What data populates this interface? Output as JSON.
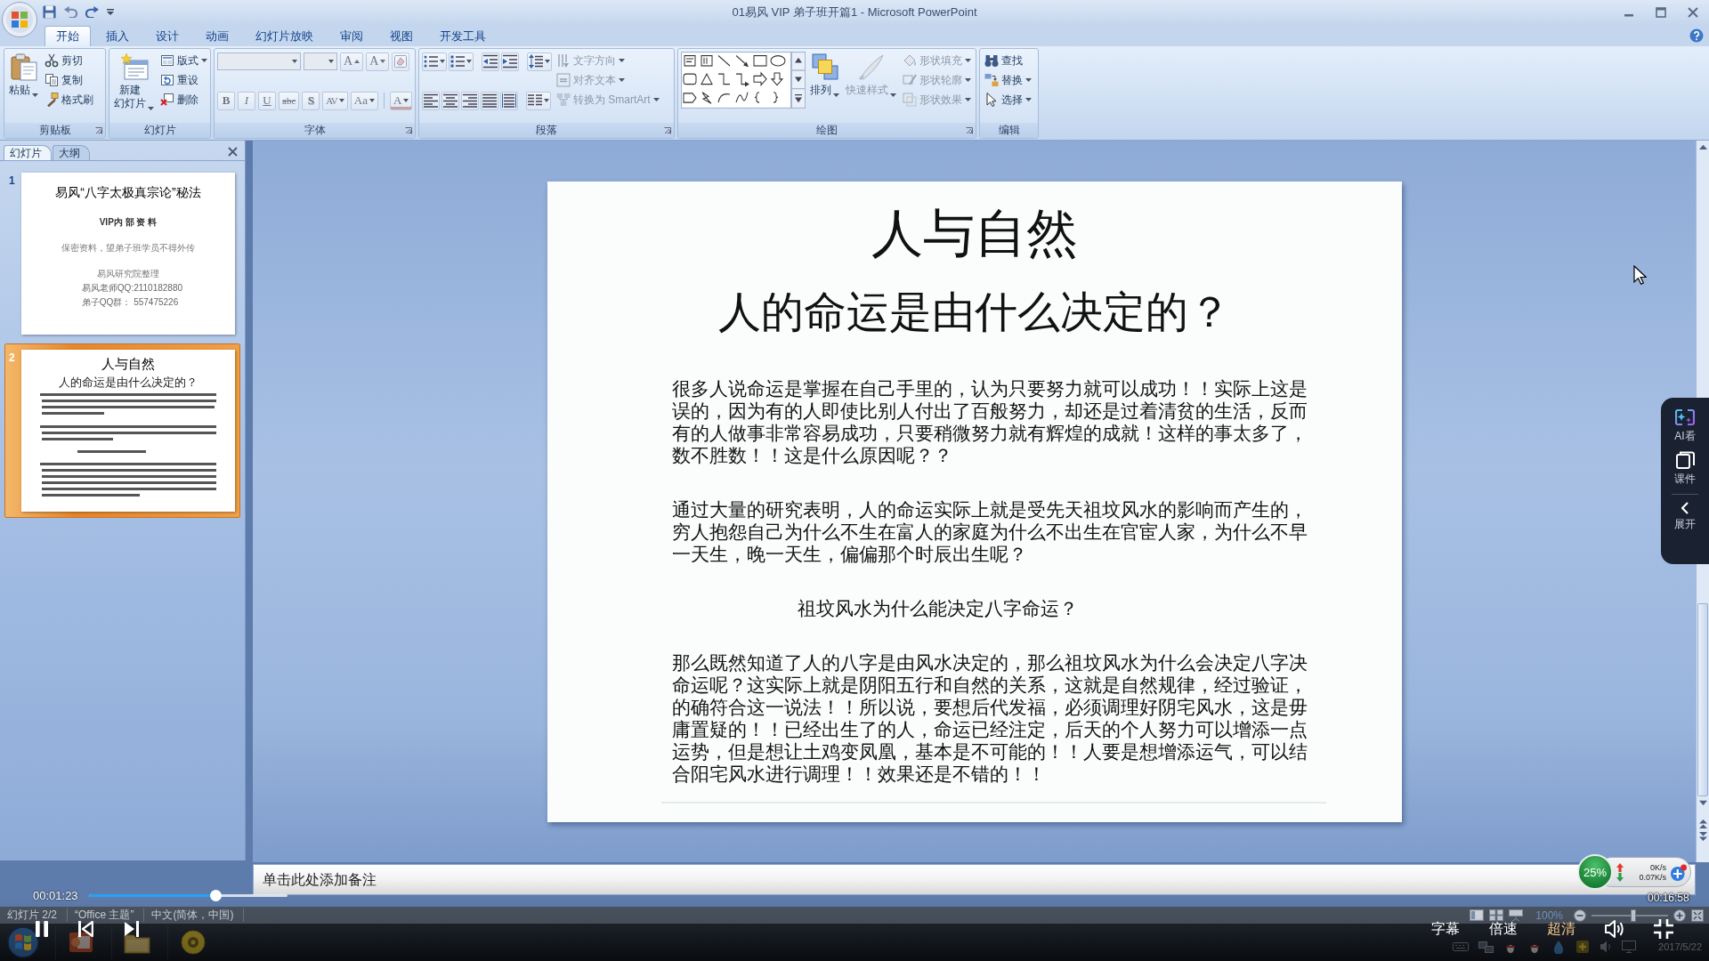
{
  "window": {
    "title": "01易风 VIP 弟子班开篇1 - Microsoft PowerPoint"
  },
  "ribbon_tabs": [
    {
      "label": "开始",
      "selected": true
    },
    {
      "label": "插入",
      "selected": false
    },
    {
      "label": "设计",
      "selected": false
    },
    {
      "label": "动画",
      "selected": false
    },
    {
      "label": "幻灯片放映",
      "selected": false
    },
    {
      "label": "审阅",
      "selected": false
    },
    {
      "label": "视图",
      "selected": false
    },
    {
      "label": "开发工具",
      "selected": false
    }
  ],
  "ribbon": {
    "clipboard": {
      "label": "剪贴板",
      "paste": {
        "label": "粘贴",
        "dropdown": true,
        "disabled": false
      },
      "actions": [
        {
          "label": "剪切",
          "dropdown": false,
          "disabled": false
        },
        {
          "label": "复制",
          "dropdown": false,
          "disabled": false
        },
        {
          "label": "格式刷",
          "dropdown": false,
          "disabled": false
        }
      ]
    },
    "slides": {
      "label": "幻灯片",
      "new_slide": {
        "label_lines": [
          "新建",
          "幻灯片"
        ],
        "dropdown": true,
        "disabled": false
      },
      "actions": [
        {
          "label": "版式",
          "dropdown": true,
          "disabled": false
        },
        {
          "label": "重设",
          "dropdown": false,
          "disabled": false
        },
        {
          "label": "删除",
          "dropdown": false,
          "disabled": false
        }
      ]
    },
    "font": {
      "label": "字体",
      "font_name": {
        "disabled": true
      },
      "font_size": {
        "disabled": true
      },
      "size_buttons": [
        {
          "label": "A",
          "kind": "grow",
          "disabled": true
        },
        {
          "label": "A",
          "kind": "shrink",
          "disabled": true
        }
      ],
      "format_buttons": [
        {
          "label": "B",
          "kind": "bold",
          "dropdown": false,
          "disabled": true
        },
        {
          "label": "I",
          "kind": "italic",
          "dropdown": false,
          "disabled": true
        },
        {
          "label": "U",
          "kind": "underline",
          "dropdown": false,
          "disabled": true
        },
        {
          "label": "abc",
          "kind": "strike",
          "dropdown": false,
          "disabled": true
        },
        {
          "label": "S",
          "kind": "shadow",
          "dropdown": false,
          "disabled": true
        },
        {
          "label": "AV",
          "kind": "spacing",
          "dropdown": true,
          "disabled": true
        },
        {
          "label": "Aa",
          "kind": "case",
          "dropdown": true,
          "disabled": true
        },
        {
          "label": "A",
          "kind": "color",
          "dropdown": true,
          "disabled": true
        }
      ]
    },
    "paragraph": {
      "label": "段落",
      "actions": [
        {
          "label": "文字方向",
          "dropdown": true,
          "disabled": true
        },
        {
          "label": "对齐文本",
          "dropdown": true,
          "disabled": true
        },
        {
          "label": "转换为 SmartArt",
          "dropdown": true,
          "disabled": true
        }
      ]
    },
    "drawing": {
      "label": "绘图",
      "arrange": {
        "label": "排列",
        "dropdown": true,
        "disabled": false
      },
      "quick_styles": {
        "label": "快速样式",
        "dropdown": true,
        "disabled": true
      },
      "actions": [
        {
          "label": "形状填充",
          "dropdown": true,
          "disabled": true
        },
        {
          "label": "形状轮廓",
          "dropdown": true,
          "disabled": true
        },
        {
          "label": "形状效果",
          "dropdown": true,
          "disabled": true
        }
      ]
    },
    "editing": {
      "label": "编辑",
      "actions": [
        {
          "label": "查找",
          "dropdown": false,
          "disabled": false
        },
        {
          "label": "替换",
          "dropdown": true,
          "disabled": false
        },
        {
          "label": "选择",
          "dropdown": true,
          "disabled": false
        }
      ]
    }
  },
  "slide_panel": {
    "tabs": [
      {
        "label": "幻灯片",
        "selected": true
      },
      {
        "label": "大纲",
        "selected": false
      }
    ],
    "slides": [
      {
        "number": "1",
        "selected": false,
        "kind": "title",
        "title": "易风“八字太极真宗论”秘法",
        "lines": [
          {
            "text": "VIP内 部 资 料",
            "kind": "heading"
          },
          {
            "text": "保密资料，望弟子班学员不得外传",
            "kind": "note"
          },
          {
            "text": "易风研究院整理",
            "kind": "note"
          },
          {
            "text": "易风老师QQ:2110182880",
            "kind": "contact"
          },
          {
            "text": "弟子QQ群： 557475226",
            "kind": "contact"
          }
        ]
      },
      {
        "number": "2",
        "selected": true,
        "kind": "content",
        "title": "人与自然",
        "subtitle": "人的命运是由什么决定的？"
      }
    ]
  },
  "slide": {
    "title": "人与自然",
    "subtitle": "人的命运是由什么决定的？",
    "paragraphs": [
      {
        "kind": "body",
        "text": "很多人说命运是掌握在自己手里的，认为只要努力就可以成功！！实际上这是误的，因为有的人即使比别人付出了百般努力，却还是过着清贫的生活，反而有的人做事非常容易成功，只要稍微努力就有辉煌的成就！这样的事太多了，数不胜数！！这是什么原因呢？？"
      },
      {
        "kind": "body",
        "text": "通过大量的研究表明，人的命运实际上就是受先天祖坟风水的影响而产生的，穷人抱怨自己为什么不生在富人的家庭为什么不出生在官宦人家，为什么不早一天生，晚一天生，偏偏那个时辰出生呢？"
      },
      {
        "kind": "heading",
        "text": "祖坟风水为什么能决定八字命运？"
      },
      {
        "kind": "body",
        "text": "那么既然知道了人的八字是由风水决定的，那么祖坟风水为什么会决定八字决命运呢？这实际上就是阴阳五行和自然的关系，这就是自然规律，经过验证，的确符合这一说法！！所以说，要想后代发福，必须调理好阴宅风水，这是毋庸置疑的！！已经出生了的人，命运已经注定，后天的个人努力可以增添一点运势，但是想让土鸡变凤凰，基本是不可能的！！人要是想增添运气，可以结合阳宅风水进行调理！！效果还是不错的！！"
      }
    ]
  },
  "notes": {
    "placeholder": "单击此处添加备注"
  },
  "status_bar": {
    "items": [
      "幻灯片 2/2",
      "“Office 主题”",
      "中文(简体，中国)"
    ],
    "zoom": "100%",
    "zoom_slider": {
      "level": 0.55
    }
  },
  "taskbar": {
    "date": "2017/5/22"
  },
  "player": {
    "playing": true,
    "current_time": "00:01:23",
    "progress": {
      "level": 0.64
    },
    "total_time": "00:16:58",
    "buttons": [
      {
        "label": "字幕",
        "highlighted": false
      },
      {
        "label": "倍速",
        "highlighted": false
      },
      {
        "label": "超清",
        "highlighted": true
      }
    ]
  },
  "side_panel": {
    "items": [
      {
        "label": "AI看",
        "kind": "ai"
      },
      {
        "label": "课件",
        "kind": "courseware"
      },
      {
        "label": "展开",
        "kind": "expand"
      }
    ]
  },
  "speed_monitor": {
    "load": "25%",
    "upload": "0K/s",
    "download": "0.07K/s"
  }
}
